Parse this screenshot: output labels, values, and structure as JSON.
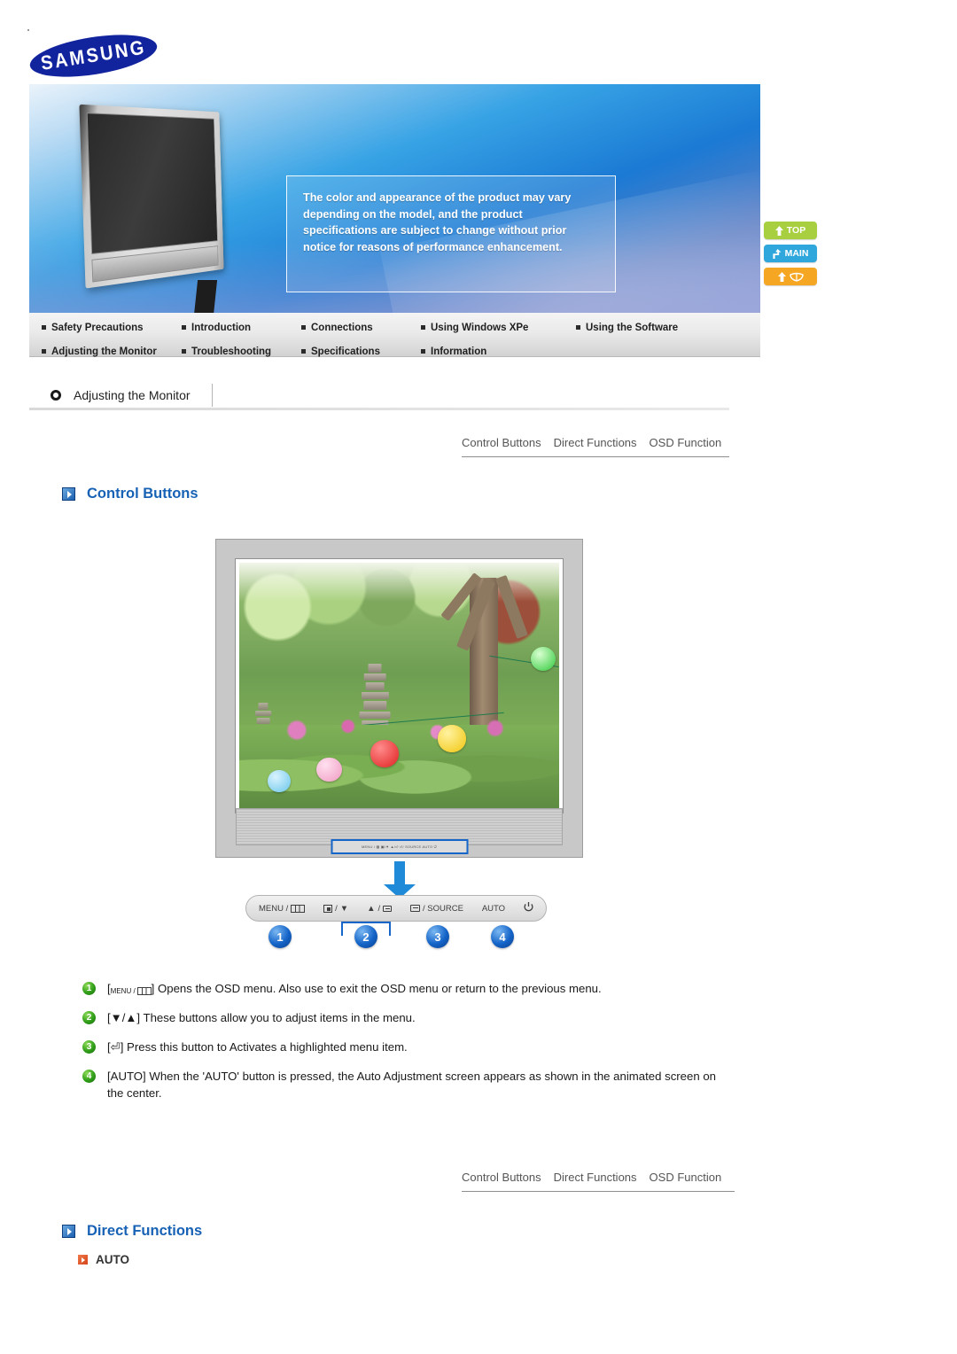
{
  "brand": {
    "logo_text": "SAMSUNG"
  },
  "banner": {
    "notice": "The color and appearance of the product may vary depending on the model, and the product specifications are subject to change without prior notice for reasons of performance enhancement.",
    "product_image_alt": "lcd-monitor-front-angled"
  },
  "nav": {
    "row1": [
      {
        "label": "Safety Precautions"
      },
      {
        "label": "Introduction"
      },
      {
        "label": "Connections"
      },
      {
        "label": "Using Windows XPe"
      },
      {
        "label": "Using the Software"
      }
    ],
    "row2": [
      {
        "label": "Adjusting the Monitor"
      },
      {
        "label": "Troubleshooting"
      },
      {
        "label": "Specifications"
      },
      {
        "label": "Information"
      }
    ]
  },
  "side_buttons": [
    {
      "label": "TOP",
      "icon": "arrow-up-icon",
      "color": "#a8cf3f"
    },
    {
      "label": "MAIN",
      "icon": "home-arrow-icon",
      "color": "#2fa7dd"
    },
    {
      "label": "",
      "icon": "book-arrow-icon",
      "color": "#f5a623"
    }
  ],
  "breadcrumb": {
    "icon": "ring-icon",
    "title": "Adjusting the Monitor"
  },
  "tabs_top": [
    {
      "label": "Control Buttons"
    },
    {
      "label": "Direct Functions"
    },
    {
      "label": "OSD Function"
    }
  ],
  "tabs_mid": [
    {
      "label": "Control Buttons"
    },
    {
      "label": "Direct Functions"
    },
    {
      "label": "OSD Function"
    }
  ],
  "sections": {
    "control_buttons": {
      "title": "Control Buttons"
    },
    "direct_functions": {
      "title": "Direct Functions"
    }
  },
  "monitor_photo": {
    "alt": "monitor-displaying-garden-pagoda-lanterns",
    "panel_hint": "MENU / ▦   ▣/▼   ▲/⏎   ⏎/ SOURCE   AUTO   ⏻"
  },
  "button_bar": [
    {
      "id": 1,
      "text_before": "MENU /",
      "glyph": "menu-bars-icon",
      "text_after": ""
    },
    {
      "id": 2,
      "glyph": "enter-box-icon",
      "text_mid": "/",
      "glyph2": "down-triangle-icon"
    },
    {
      "id": 3,
      "glyph": "up-triangle-icon",
      "text_mid": "/",
      "glyph2": "return-icon"
    },
    {
      "id": 4,
      "glyph": "source-icon",
      "text_after": "/ SOURCE"
    },
    {
      "id": 5,
      "text": "AUTO"
    },
    {
      "id": 6,
      "glyph": "power-icon"
    }
  ],
  "button_bar_labels": {
    "menu": "MENU /",
    "slash": "/",
    "source": "/ SOURCE",
    "auto": "AUTO"
  },
  "callout_numbers": [
    "1",
    "2",
    "3",
    "4"
  ],
  "descriptions": [
    {
      "num": "1",
      "prefix": "[",
      "glyph_text": "MENU /",
      "suffix": "] Opens the OSD menu. Also use to exit the OSD menu or return to the previous menu."
    },
    {
      "num": "2",
      "text": "[▼/▲] These buttons allow you to adjust items in the menu."
    },
    {
      "num": "3",
      "text": "[⏎] Press this button to Activates a highlighted menu item."
    },
    {
      "num": "4",
      "text": "[AUTO] When the 'AUTO' button is pressed, the Auto Adjustment screen appears as shown in the animated screen on the center."
    }
  ],
  "direct_function_items": [
    {
      "label": "AUTO"
    }
  ],
  "colors": {
    "heading_blue": "#1862b5",
    "samsung_blue": "#12239e",
    "accent_orange": "#d4441a",
    "green_bullet": "#2f9e18",
    "blue_bullet": "#1464c8"
  }
}
